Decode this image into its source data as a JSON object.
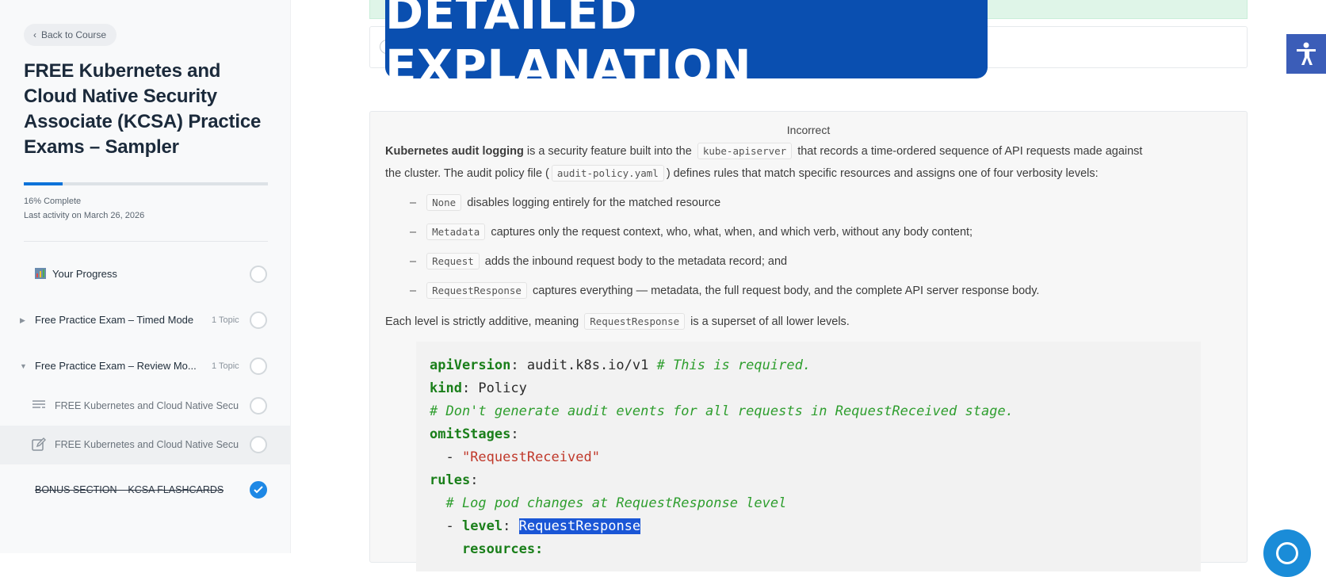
{
  "sidebar": {
    "back_label": "Back to Course",
    "course_title": "FREE Kubernetes and Cloud Native Security Associate (KCSA) Practice Exams – Sampler",
    "progress_pct": 16,
    "progress_text": "16% Complete",
    "last_activity": "Last activity on March 26, 2026",
    "items": [
      {
        "icon": "chart-icon",
        "label": "Your Progress",
        "topic": "",
        "completed": false
      },
      {
        "icon": "caret-right-icon",
        "label": "Free Practice Exam – Timed Mode",
        "topic": "1 Topic",
        "completed": false
      },
      {
        "icon": "caret-down-icon",
        "label": "Free Practice Exam – Review Mo...",
        "topic": "1 Topic",
        "completed": false
      },
      {
        "icon": "lines-icon",
        "label": "FREE Kubernetes and Cloud Native Secu",
        "topic": "",
        "completed": false
      },
      {
        "icon": "edit-icon",
        "label": "FREE Kubernetes and Cloud Native Secu",
        "topic": "",
        "completed": false
      },
      {
        "icon": "",
        "label": "BONUS SECTION – KCSA FLASHCARDS",
        "topic": "",
        "completed": true
      }
    ]
  },
  "banner": {
    "text": "DETAILED EXPLANATION"
  },
  "explanation": {
    "status": "Incorrect",
    "intro_bold": "Kubernetes audit logging",
    "intro_1": " is a security feature built into the ",
    "code_apiserver": "kube-apiserver",
    "intro_2": " that records a time-ordered sequence of API requests made against",
    "intro_3": "the cluster. The audit policy file (",
    "code_policy": "audit-policy.yaml",
    "intro_4": ") defines rules that match specific resources and assigns one of four verbosity levels:",
    "levels": [
      {
        "code": "None",
        "text": "disables logging entirely for the matched resource"
      },
      {
        "code": "Metadata",
        "text": "captures only the request context, who, what, when, and which verb, without any body content;"
      },
      {
        "code": "Request",
        "text": "adds the inbound request body to the metadata record; and"
      },
      {
        "code": "RequestResponse",
        "text": "captures everything — metadata, the full request body, and the complete API server response body."
      }
    ],
    "summary_1": "Each level is strictly additive, meaning ",
    "summary_code": "RequestResponse",
    "summary_2": " is a superset of all lower levels.",
    "yaml": {
      "l1_key": "apiVersion",
      "l1_val": ": audit.k8s.io/v1 ",
      "l1_comment": "# This is required.",
      "l2_key": "kind",
      "l2_val": ": Policy",
      "l3_comment": "# Don't generate audit events for all requests in RequestReceived stage.",
      "l4_key": "omitStages",
      "l4_val": ":",
      "l5_dash": "  - ",
      "l5_str": "\"RequestReceived\"",
      "l6_key": "rules",
      "l6_val": ":",
      "l7_comment": "  # Log pod changes at RequestResponse level",
      "l8_dash": "  - ",
      "l8_key": "level",
      "l8_colon": ": ",
      "l8_sel": "RequestResponse",
      "l9_text": "    resources:"
    }
  },
  "colors": {
    "accent": "#0d73d9",
    "banner": "#0a4fb0",
    "complete": "#1e88e5"
  }
}
